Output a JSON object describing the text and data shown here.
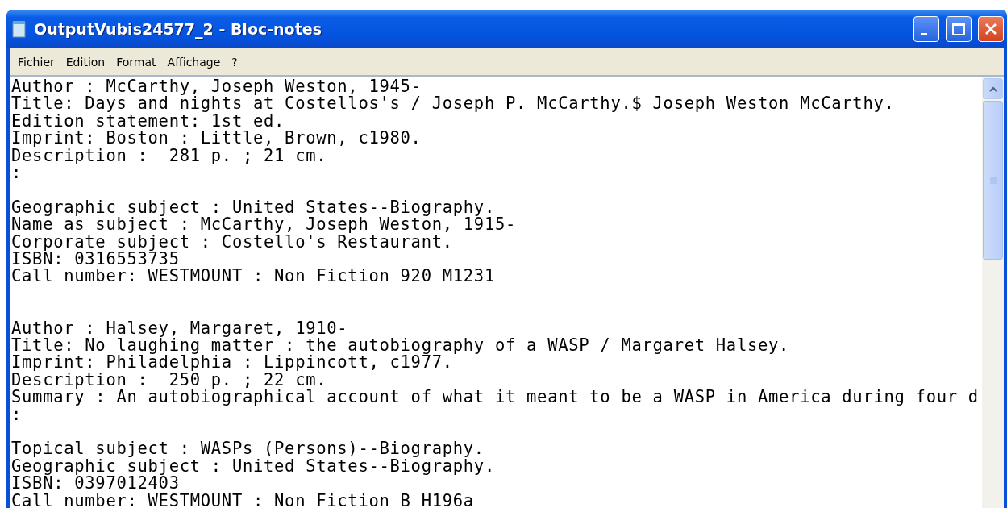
{
  "window": {
    "title": "OutputVubis24577_2 - Bloc-notes"
  },
  "menu": [
    "Fichier",
    "Edition",
    "Format",
    "Affichage",
    "?"
  ],
  "blocks": [
    {
      "kind": "record",
      "lines": [
        "Author : McCarthy, Joseph Weston, 1945-",
        "Title: Days and nights at Costellos's / Joseph P. McCarthy.$ Joseph Weston McCarthy.",
        "Edition statement: 1st ed.",
        "Imprint: Boston : Little, Brown, c1980.",
        "Description :  281 p. ; 21 cm.",
        ":"
      ]
    },
    {
      "kind": "subjects",
      "lines": [
        "Geographic subject : United States--Biography.",
        "Name as subject : McCarthy, Joseph Weston, 1915-",
        "Corporate subject : Costello's Restaurant.",
        "ISBN: 0316553735",
        "Call number: WESTMOUNT : Non Fiction 920 M1231"
      ]
    },
    {
      "kind": "record",
      "lines": [
        "Author : Halsey, Margaret, 1910-",
        "Title: No laughing matter : the autobiography of a WASP / Margaret Halsey.",
        "Imprint: Philadelphia : Lippincott, c1977.",
        "Description :  250 p. ; 22 cm.",
        "Summary : An autobiographical account of what it meant to be a WASP in America during four d",
        ":"
      ]
    },
    {
      "kind": "subjects",
      "lines": [
        "Topical subject : WASPs (Persons)--Biography.",
        "Geographic subject : United States--Biography.",
        "ISBN: 0397012403",
        "Call number: WESTMOUNT : Non Fiction B H196a"
      ]
    }
  ]
}
